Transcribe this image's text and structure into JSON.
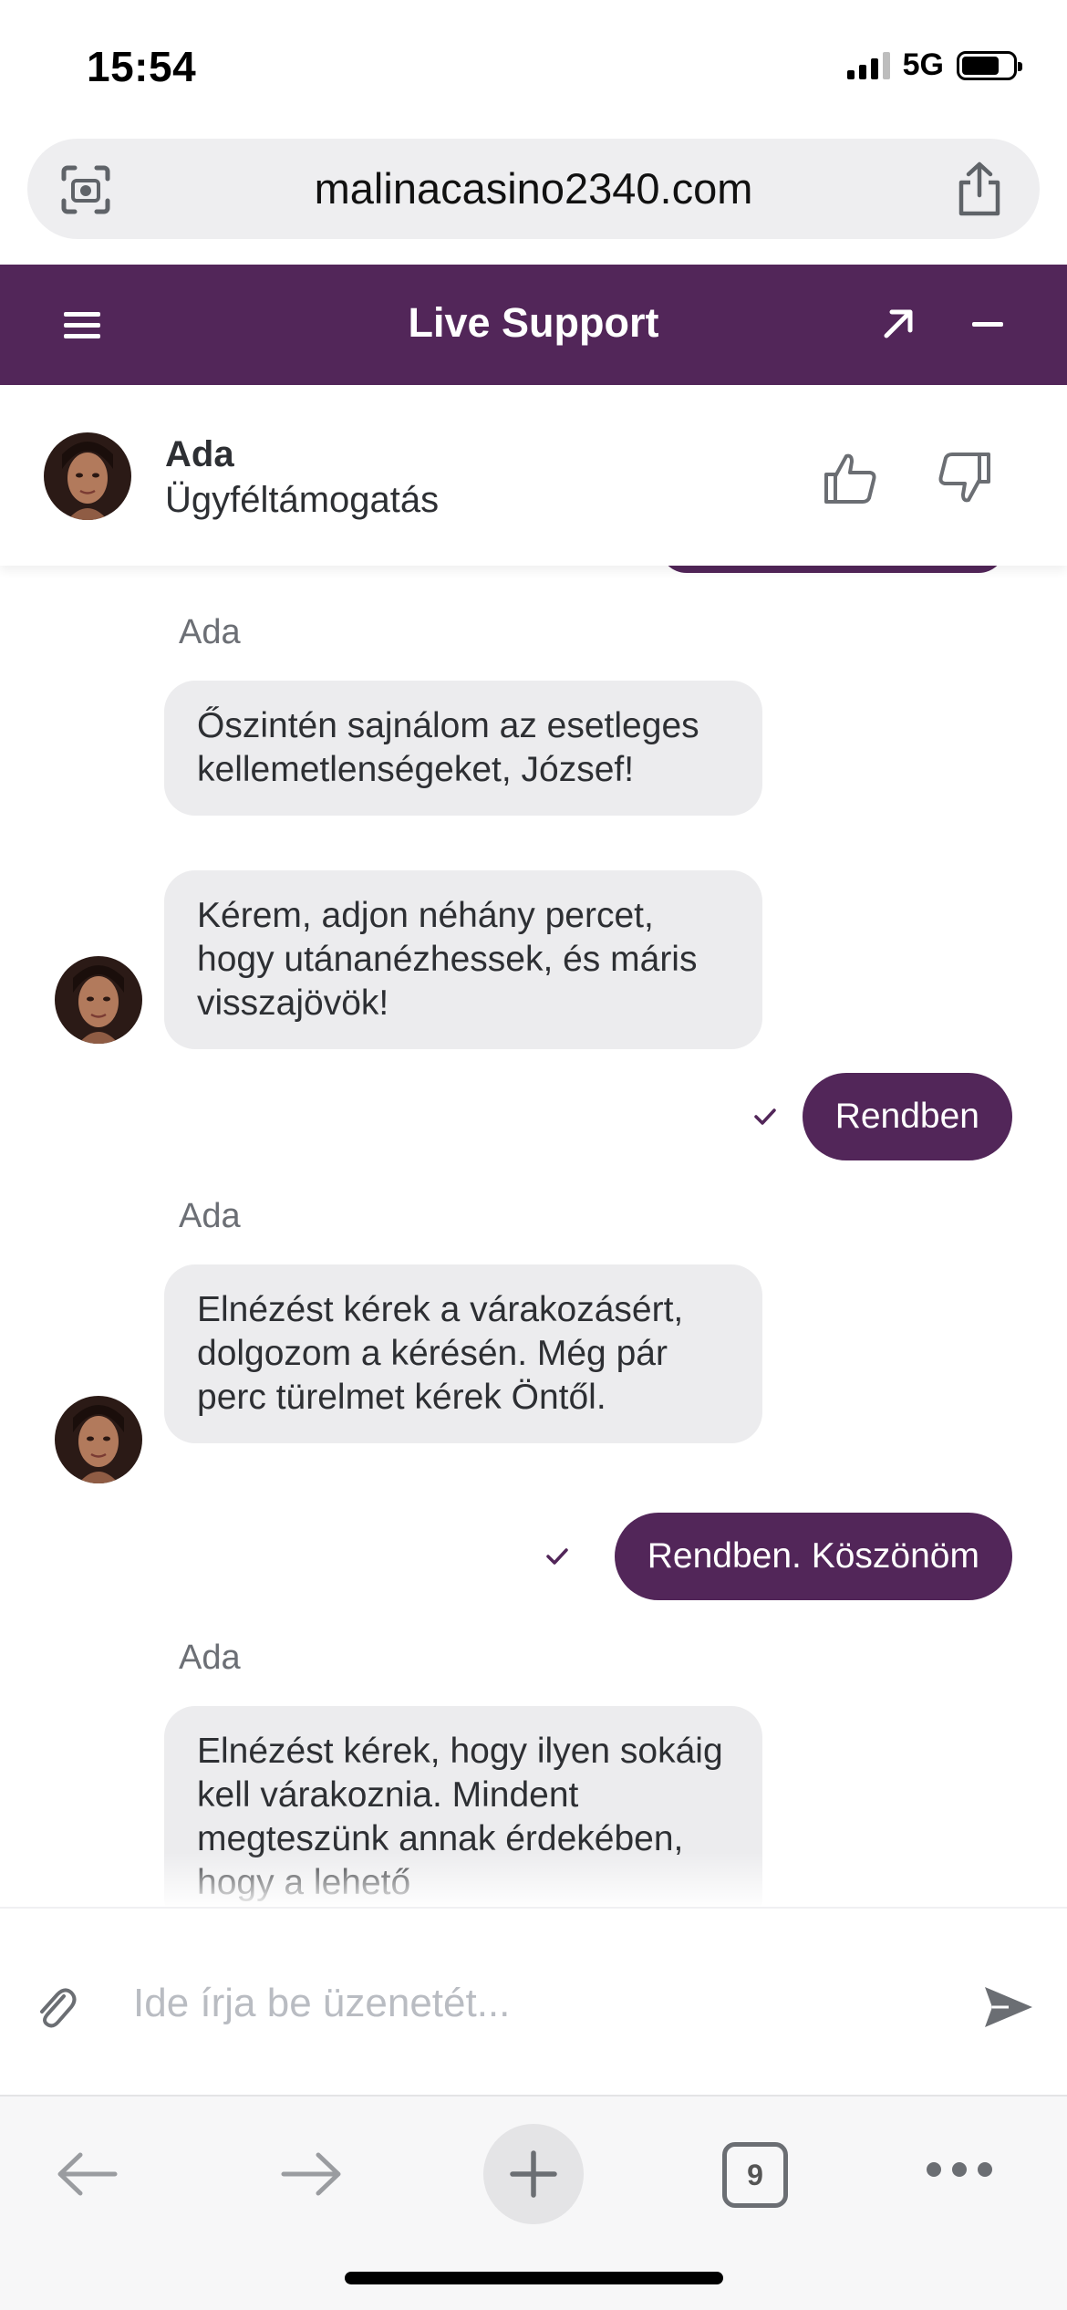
{
  "status_bar": {
    "time": "15:54",
    "network": "5G"
  },
  "browser": {
    "url": "malinacasino2340.com",
    "tab_count": "9"
  },
  "header": {
    "title": "Live Support"
  },
  "agent": {
    "name": "Ada",
    "role": "Ügyféltámogatás"
  },
  "messages": [
    {
      "from": "agent",
      "sender": "Ada",
      "texts": [
        "Őszintén sajnálom az esetleges kellemetlenségeket, József!",
        "Kérem, adjon néhány percet, hogy utánanézhessek, és máris visszajövök!"
      ]
    },
    {
      "from": "user",
      "text": "Rendben"
    },
    {
      "from": "agent",
      "sender": "Ada",
      "texts": [
        "Elnézést kérek a várakozásért, dolgozom a kérésén. Még pár perc türelmet kérek Öntől."
      ]
    },
    {
      "from": "user",
      "text": "Rendben. Köszönöm"
    },
    {
      "from": "agent",
      "sender": "Ada",
      "texts": [
        "Elnézést kérek, hogy ilyen sokáig kell várakoznia. Mindent megteszünk annak érdekében, hogy a lehető"
      ]
    }
  ],
  "composer": {
    "placeholder": "Ide írja be üzenetét..."
  },
  "colors": {
    "brand": "#522659",
    "bubble_in": "#ececee",
    "text": "#2d2f33"
  }
}
